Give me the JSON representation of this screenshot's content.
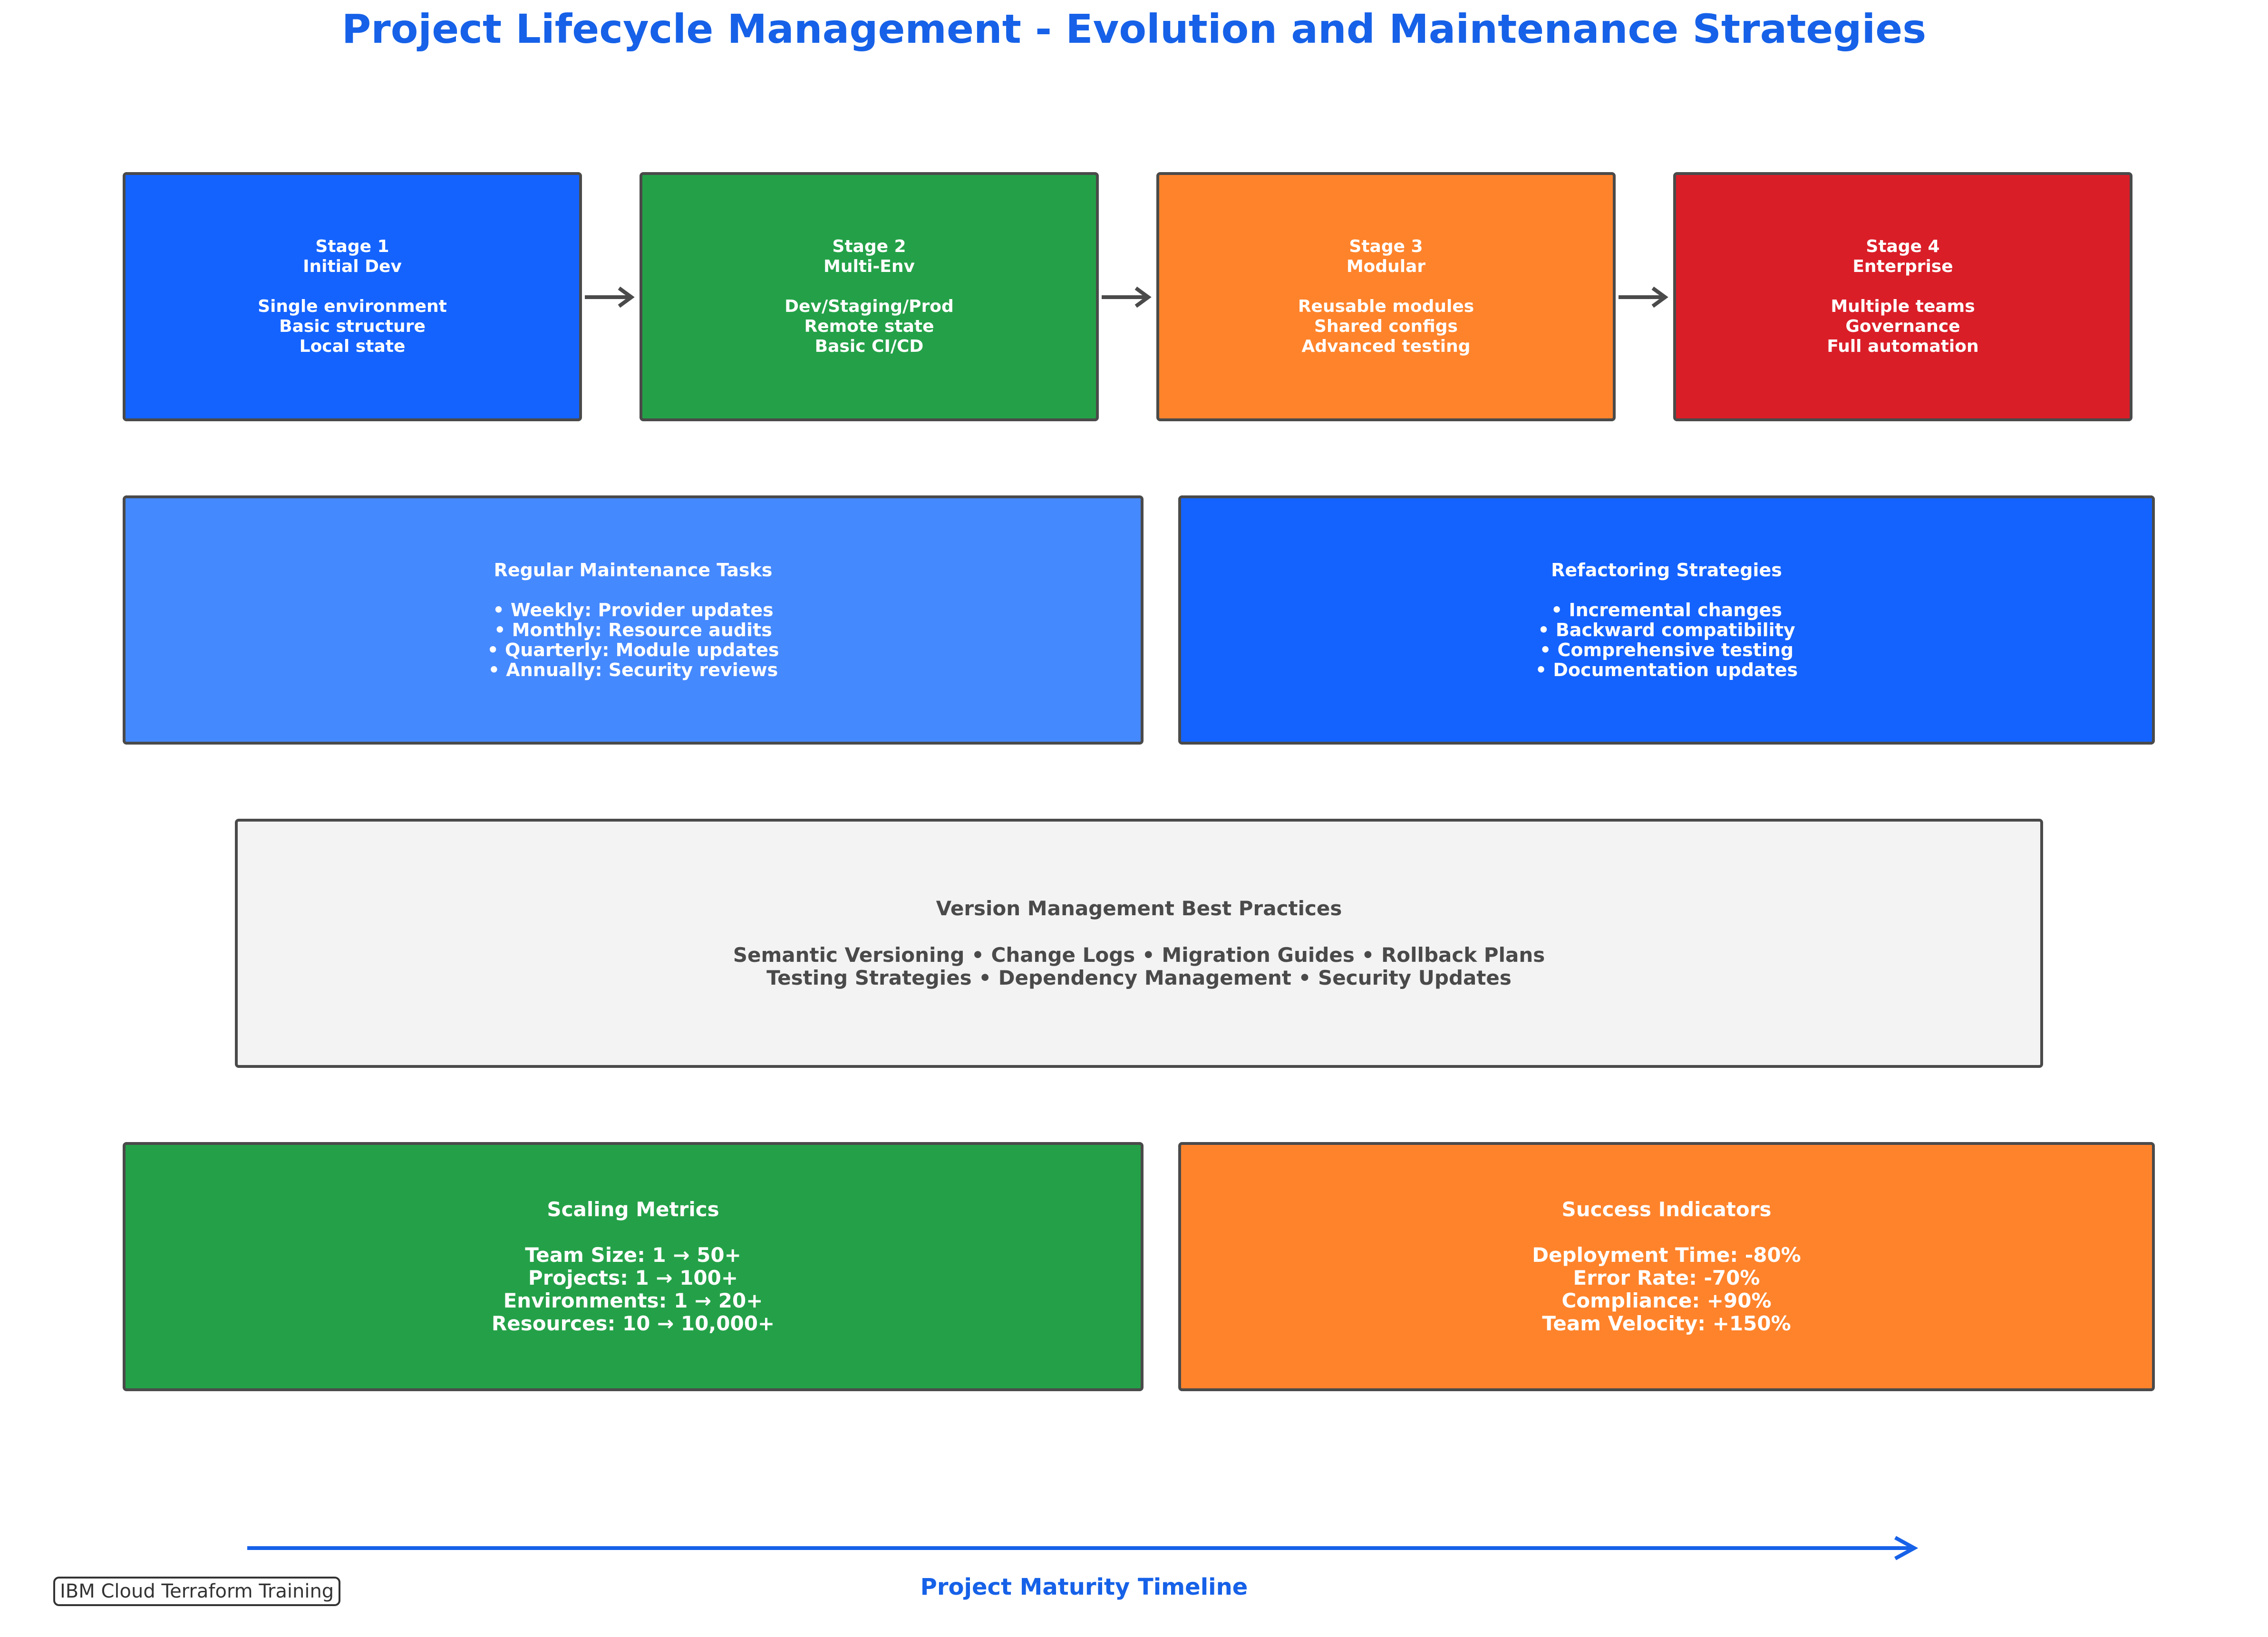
{
  "title": "Project Lifecycle Management - Evolution and Maintenance Strategies",
  "stages": [
    {
      "name": "Stage 1",
      "subtitle": "Initial Dev",
      "items": [
        "Single environment",
        "Basic structure",
        "Local state"
      ],
      "color": "#1463ff"
    },
    {
      "name": "Stage 2",
      "subtitle": "Multi-Env",
      "items": [
        "Dev/Staging/Prod",
        "Remote state",
        "Basic CI/CD"
      ],
      "color": "#24a148"
    },
    {
      "name": "Stage 3",
      "subtitle": "Modular",
      "items": [
        "Reusable modules",
        "Shared configs",
        "Advanced testing"
      ],
      "color": "#ff832b"
    },
    {
      "name": "Stage 4",
      "subtitle": "Enterprise",
      "items": [
        "Multiple teams",
        "Governance",
        "Full automation"
      ],
      "color": "#da1e28"
    }
  ],
  "maintenance": {
    "title": "Regular Maintenance Tasks",
    "items": [
      "• Weekly: Provider updates",
      "• Monthly: Resource audits",
      "• Quarterly: Module updates",
      "• Annually: Security reviews"
    ],
    "color": "#4589ff"
  },
  "refactoring": {
    "title": "Refactoring Strategies",
    "items": [
      "• Incremental changes",
      "• Backward compatibility",
      "• Comprehensive testing",
      "• Documentation updates"
    ],
    "color": "#1463ff"
  },
  "version_management": {
    "title": "Version Management Best Practices",
    "lines": [
      "Semantic Versioning • Change Logs • Migration Guides • Rollback Plans",
      "Testing Strategies • Dependency Management • Security Updates"
    ],
    "color": "#f3f3f3"
  },
  "scaling": {
    "title": "Scaling Metrics",
    "items": [
      "Team Size: 1 → 50+",
      "Projects: 1 → 100+",
      "Environments: 1 → 20+",
      "Resources: 10 → 10,000+"
    ],
    "color": "#24a148"
  },
  "success": {
    "title": "Success Indicators",
    "items": [
      "Deployment Time: -80%",
      "Error Rate: -70%",
      "Compliance: +90%",
      "Team Velocity: +150%"
    ],
    "color": "#ff832b"
  },
  "timeline_label": "Project Maturity Timeline",
  "footer_badge": "IBM Cloud Terraform Training",
  "colors": {
    "accent": "#1661e8",
    "border": "#4a4a4a"
  }
}
